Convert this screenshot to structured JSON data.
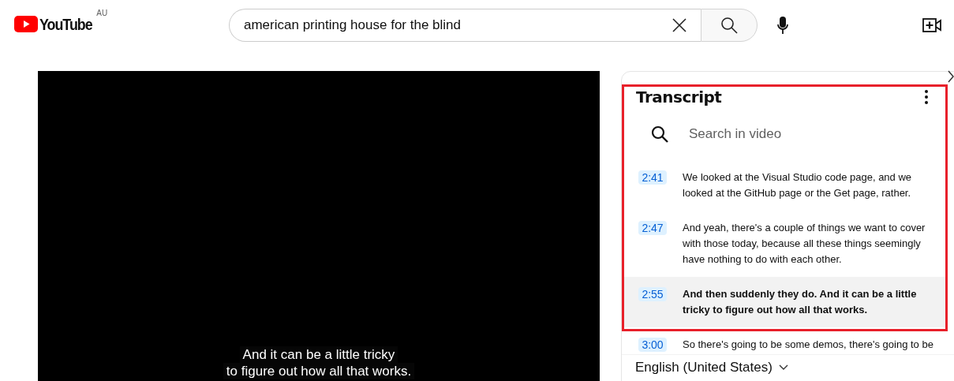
{
  "header": {
    "logo": "YouTube",
    "region": "AU",
    "search": {
      "value": "american printing house for the blind"
    }
  },
  "video": {
    "captions": [
      "And it can be a little tricky",
      "to figure out how all that works."
    ]
  },
  "transcript": {
    "title": "Transcript",
    "search": {
      "placeholder": "Search in video"
    },
    "segments": [
      {
        "time": "2:41",
        "text": "We looked at the Visual Studio code page, and we looked at the GitHub page or the Get page, rather.",
        "selected": false
      },
      {
        "time": "2:47",
        "text": "And yeah, there's a couple of things we want to cover with those today, because all these things seemingly have nothing to do with each other.",
        "selected": false
      },
      {
        "time": "2:55",
        "text": "And then suddenly they do. And it can be a little tricky to figure out how all that works.",
        "selected": true
      },
      {
        "time": "3:00",
        "text": "So there's going to be some demos, there's going to be",
        "selected": false
      }
    ],
    "language": "English (United States)"
  }
}
